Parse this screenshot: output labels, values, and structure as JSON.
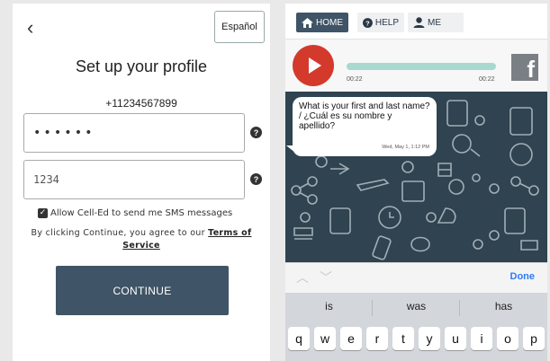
{
  "profile": {
    "back_glyph": "‹",
    "language_button": "Español",
    "title": "Set up your profile",
    "phone": "+11234567899",
    "password_value": "••••••",
    "pin_value": "1234",
    "help_glyph": "?",
    "sms_opt_in": "Allow Cell-Ed to send me SMS messages",
    "terms_prefix": "By clicking Continue, you agree to our",
    "terms_link": "Terms of Service",
    "continue_label": "CONTINUE"
  },
  "nav": {
    "home": "HOME",
    "help": "HELP",
    "me": "ME"
  },
  "player": {
    "elapsed": "00:22",
    "total": "00:22",
    "progress": 1.0,
    "facebook_glyph": "f"
  },
  "chat": {
    "message": "What is your first and last name? / ¿Cuál es su nombre y apellido?",
    "timestamp": "Wed, May 1, 1:12 PM"
  },
  "keyboard": {
    "done": "Done",
    "suggestions": [
      "is",
      "was",
      "has"
    ],
    "row1": [
      "q",
      "w",
      "e",
      "r",
      "t",
      "y",
      "u",
      "i",
      "o",
      "p"
    ]
  },
  "colors": {
    "accent": "#3f5466",
    "play": "#d33a2c",
    "progress": "#a8d9cf",
    "chat_bg": "#2f4350",
    "done": "#2f7bf6"
  }
}
